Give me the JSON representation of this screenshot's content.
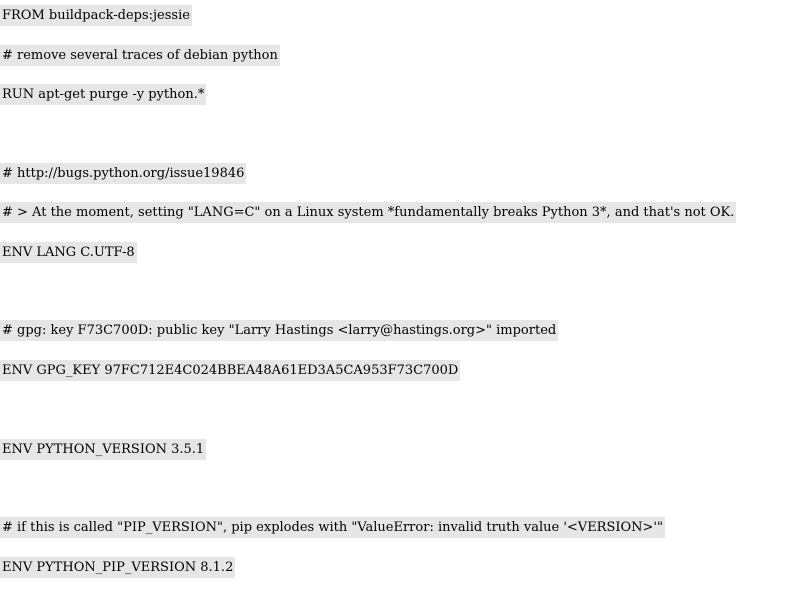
{
  "document": {
    "lines": [
      "FROM buildpack-deps:jessie",
      "# remove several traces of debian python",
      "RUN apt-get purge -y python.*",
      "# http://bugs.python.org/issue19846",
      "# > At the moment, setting \"LANG=C\" on a Linux system *fundamentally breaks Python 3*, and that's not OK.",
      "ENV LANG C.UTF-8",
      "# gpg: key F73C700D: public key \"Larry Hastings <larry@hastings.org>\" imported",
      "ENV GPG_KEY 97FC712E4C024BBEA48A61ED3A5CA953F73C700D",
      "ENV PYTHON_VERSION 3.5.1",
      "# if this is called \"PIP_VERSION\", pip explodes with \"ValueError: invalid truth value '<VERSION>'\"",
      "ENV PYTHON_PIP_VERSION 8.1.2"
    ]
  }
}
